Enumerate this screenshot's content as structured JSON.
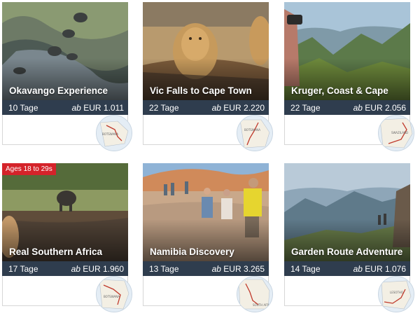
{
  "cards": [
    {
      "title": "Okavango Experience",
      "days": "10 Tage",
      "price_prefix": "ab",
      "price": "EUR 1.011",
      "map_icon": "route-map-icon",
      "photo": "elephants-aerial-photo"
    },
    {
      "title": "Vic Falls to Cape Town",
      "days": "22 Tage",
      "price_prefix": "ab",
      "price": "EUR 2.220",
      "map_icon": "route-map-icon",
      "photo": "lions-photo"
    },
    {
      "title": "Kruger, Coast & Cape",
      "days": "22 Tage",
      "price_prefix": "ab",
      "price": "EUR 2.056",
      "map_icon": "route-map-icon",
      "photo": "mountains-photo"
    },
    {
      "title": "Real Southern Africa",
      "days": "17 Tage",
      "price_prefix": "ab",
      "price": "EUR 1.960",
      "map_icon": "route-map-icon",
      "photo": "elephant-river-photo",
      "badge": "Ages 18 to 29s"
    },
    {
      "title": "Namibia Discovery",
      "days": "13 Tage",
      "price_prefix": "ab",
      "price": "EUR 3.265",
      "map_icon": "route-map-icon",
      "photo": "dunes-hikers-photo"
    },
    {
      "title": "Garden Route Adventure",
      "days": "14 Tage",
      "price_prefix": "ab",
      "price": "EUR 1.076",
      "map_icon": "route-map-icon",
      "photo": "drakensberg-photo"
    }
  ],
  "colors": {
    "bar": "#2f3d4e",
    "badge": "#d4232a"
  }
}
